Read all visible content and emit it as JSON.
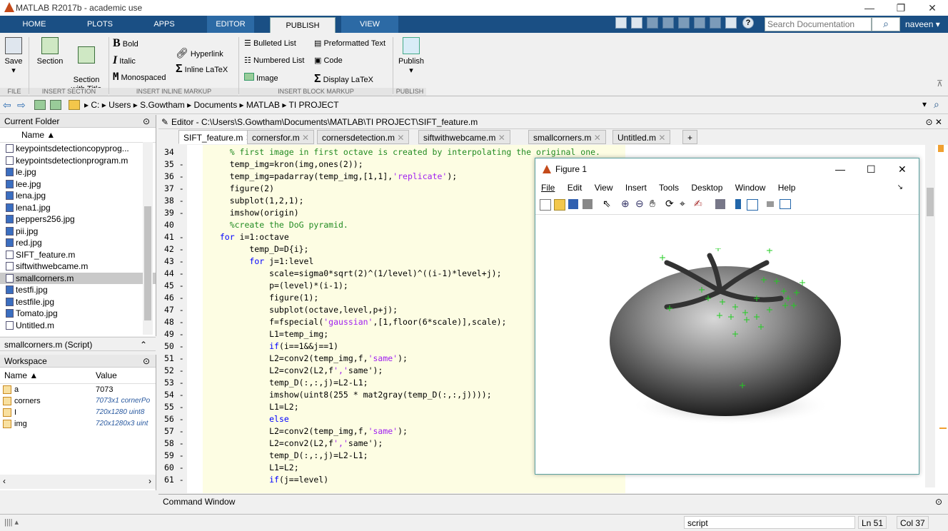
{
  "window": {
    "title": "MATLAB R2017b - academic use"
  },
  "tabs": [
    "HOME",
    "PLOTS",
    "APPS",
    "EDITOR",
    "PUBLISH",
    "VIEW"
  ],
  "search": {
    "placeholder": "Search Documentation"
  },
  "user": "naveen ▾",
  "ribbon": {
    "save": "Save",
    "section": "Section",
    "section_with_title": "Section\nwith Title",
    "bold": "Bold",
    "italic": "Italic",
    "monospaced": "Monospaced",
    "hyperlink": "Hyperlink",
    "inline_latex": "Inline LaTeX",
    "bulleted": "Bulleted List",
    "numbered": "Numbered List",
    "image": "Image",
    "preformatted": "Preformatted Text",
    "code": "Code",
    "display_latex": "Display LaTeX",
    "publish": "Publish",
    "groups": [
      "FILE",
      "INSERT SECTION",
      "INSERT INLINE MARKUP",
      "INSERT BLOCK MARKUP",
      "PUBLISH"
    ]
  },
  "breadcrumb": [
    "C:",
    "Users",
    "S.Gowtham",
    "Documents",
    "MATLAB",
    "TI PROJECT"
  ],
  "current_folder": {
    "title": "Current Folder",
    "column": "Name ▲",
    "files": [
      "keypointsdetectioncopyprog...",
      "keypointsdetectionprogram.m",
      "le.jpg",
      "lee.jpg",
      "lena.jpg",
      "lena1.jpg",
      "peppers256.jpg",
      "pii.jpg",
      "red.jpg",
      "SIFT_feature.m",
      "siftwithwebcame.m",
      "smallcorners.m",
      "testfi.jpg",
      "testfile.jpg",
      "Tomato.jpg",
      "Untitled.m"
    ],
    "selected": "smallcorners.m",
    "details": "smallcorners.m  (Script)"
  },
  "workspace": {
    "title": "Workspace",
    "col_name": "Name ▲",
    "col_value": "Value",
    "rows": [
      {
        "name": "a",
        "value": "7073"
      },
      {
        "name": "corners",
        "value": "7073x1 cornerPo"
      },
      {
        "name": "I",
        "value": "720x1280 uint8"
      },
      {
        "name": "img",
        "value": "720x1280x3 uint"
      }
    ]
  },
  "editor": {
    "title": "Editor - C:\\Users\\S.Gowtham\\Documents\\MATLAB\\TI PROJECT\\SIFT_feature.m",
    "tabs": [
      "SIFT_feature.m",
      "cornersfor.m",
      "cornersdetection.m",
      "siftwithwebcame.m",
      "smallcorners.m",
      "Untitled.m"
    ],
    "lines": [
      {
        "n": "34",
        "c": "    % first image in first octave is created by interpolating the original one."
      },
      {
        "n": "35 -",
        "c": "    temp_img=kron(img,ones(2));"
      },
      {
        "n": "36 -",
        "c": "    temp_img=padarray(temp_img,[1,1],'replicate');"
      },
      {
        "n": "37 -",
        "c": "    figure(2)"
      },
      {
        "n": "38 -",
        "c": "    subplot(1,2,1);"
      },
      {
        "n": "39 -",
        "c": "    imshow(origin)"
      },
      {
        "n": "40",
        "c": "    %create the DoG pyramid."
      },
      {
        "n": "41 -",
        "c": "  for i=1:octave"
      },
      {
        "n": "42 -",
        "c": "        temp_D=D{i};"
      },
      {
        "n": "43 -",
        "c": "        for j=1:level"
      },
      {
        "n": "44 -",
        "c": "            scale=sigma0*sqrt(2)^(1/level)^((i-1)*level+j);"
      },
      {
        "n": "45 -",
        "c": "            p=(level)*(i-1);"
      },
      {
        "n": "46 -",
        "c": "            figure(1);"
      },
      {
        "n": "47 -",
        "c": "            subplot(octave,level,p+j);"
      },
      {
        "n": "48 -",
        "c": "            f=fspecial('gaussian',[1,floor(6*scale)],scale);"
      },
      {
        "n": "49 -",
        "c": "            L1=temp_img;"
      },
      {
        "n": "50 -",
        "c": "            if(i==1&&j==1)"
      },
      {
        "n": "51 -",
        "c": "            L2=conv2(temp_img,f,'same');"
      },
      {
        "n": "52 -",
        "c": "            L2=conv2(L2,f','same');"
      },
      {
        "n": "53 -",
        "c": "            temp_D(:,:,j)=L2-L1;"
      },
      {
        "n": "54 -",
        "c": "            imshow(uint8(255 * mat2gray(temp_D(:,:,j))));"
      },
      {
        "n": "55 -",
        "c": "            L1=L2;"
      },
      {
        "n": "56 -",
        "c": "            else"
      },
      {
        "n": "57 -",
        "c": "            L2=conv2(temp_img,f,'same');"
      },
      {
        "n": "58 -",
        "c": "            L2=conv2(L2,f','same');"
      },
      {
        "n": "59 -",
        "c": "            temp_D(:,:,j)=L2-L1;"
      },
      {
        "n": "60 -",
        "c": "            L1=L2;"
      },
      {
        "n": "61 -",
        "c": "            if(j==level)"
      }
    ]
  },
  "figure": {
    "title": "Figure 1",
    "menu": [
      "File",
      "Edit",
      "View",
      "Insert",
      "Tools",
      "Desktop",
      "Window",
      "Help"
    ]
  },
  "command_window": {
    "title": "Command Window"
  },
  "status": {
    "mode": "script",
    "ln": "Ln  51",
    "col": "Col  37"
  },
  "colors": {
    "ribbon_tabs": "#1a4f84",
    "marker": "#22cc22"
  }
}
